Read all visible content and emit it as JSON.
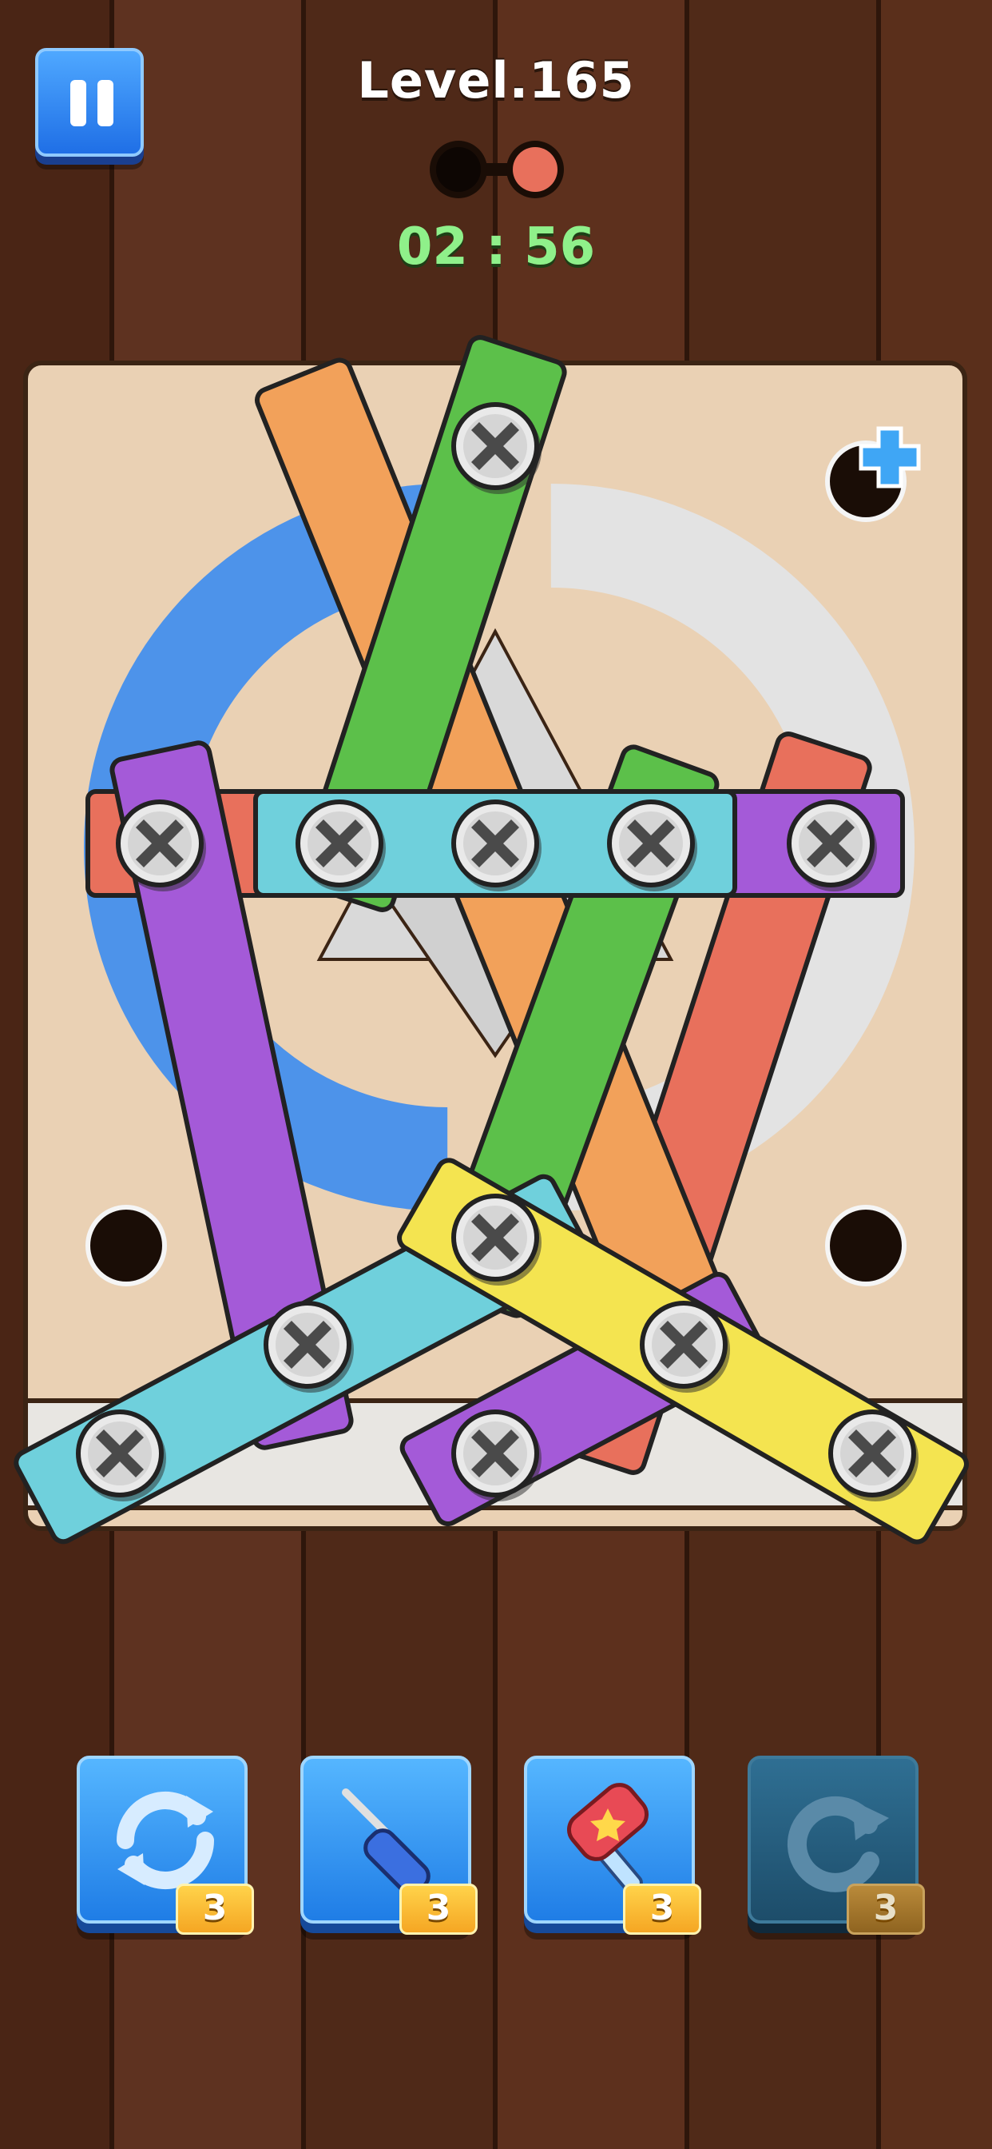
{
  "header": {
    "level_title": "Level.165",
    "timer": "02 : 56",
    "progress": {
      "total": 2,
      "completed": 1
    }
  },
  "board": {
    "extra_slot_icon": "plus-icon",
    "screw_icon": "phillips-screw-icon"
  },
  "tools": [
    {
      "name": "shuffle-tool",
      "icon": "refresh-arrows-icon",
      "count": "3",
      "enabled": true
    },
    {
      "name": "screwdriver-tool",
      "icon": "screwdriver-icon",
      "count": "3",
      "enabled": true
    },
    {
      "name": "hammer-tool",
      "icon": "hammer-icon",
      "count": "3",
      "enabled": true
    },
    {
      "name": "undo-tool",
      "icon": "undo-icon",
      "count": "3",
      "enabled": false
    }
  ],
  "colors": {
    "green": "#5cc04a",
    "orange": "#f2a15a",
    "red": "#e8705c",
    "purple": "#a45ad8",
    "cyan": "#6fd0dc",
    "yellow": "#f4e450",
    "blue_ring": "#4d93ea",
    "board": "#ead1b4"
  }
}
